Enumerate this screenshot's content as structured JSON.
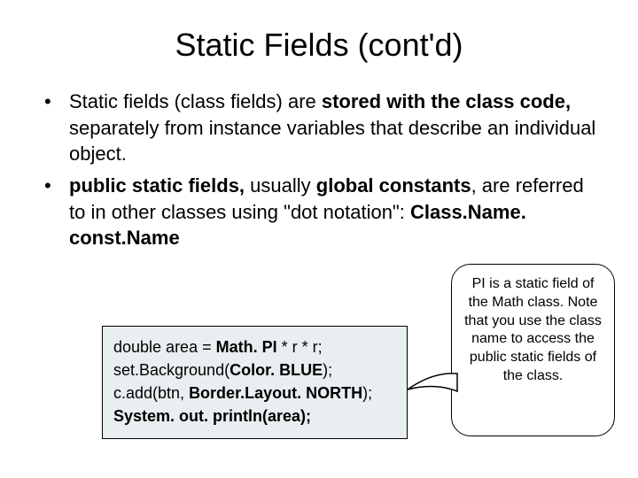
{
  "title": "Static Fields (cont'd)",
  "bullets": [
    {
      "pre": "Static fields (class fields) are ",
      "bold1": "stored with the class code,",
      "post1": " separately from instance variables that describe an individual object."
    },
    {
      "bold1": "public static fields,",
      "mid": " usually ",
      "bold2": "global constants",
      "post1": ", are referred to in other classes using \"dot notation\": ",
      "bold3": "Class.Name. const.Name"
    }
  ],
  "code": {
    "l1a": "double area = ",
    "l1b": "Math. PI",
    "l1c": " * r * r;",
    "l2a": "set.Background(",
    "l2b": "Color. BLUE",
    "l2c": ");",
    "l3a": "c.add(btn, ",
    "l3b": "Border.Layout. NORTH",
    "l3c": ");",
    "l4": "System. out. println(area);"
  },
  "callout": "PI is a static field of the Math class. Note that you use the class name to access the public static fields of the class."
}
